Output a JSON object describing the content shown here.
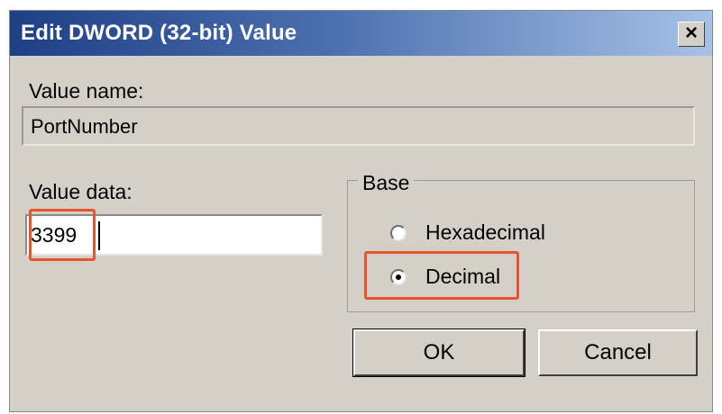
{
  "window": {
    "title": "Edit DWORD (32-bit) Value",
    "close_glyph": "✕"
  },
  "value_name": {
    "label": "Value name:",
    "value": "PortNumber"
  },
  "value_data": {
    "label": "Value data:",
    "value": "3399"
  },
  "base": {
    "legend": "Base",
    "options": [
      {
        "label": "Hexadecimal",
        "selected": false
      },
      {
        "label": "Decimal",
        "selected": true
      }
    ]
  },
  "buttons": {
    "ok": "OK",
    "cancel": "Cancel"
  },
  "colors": {
    "highlight": "#e6552f",
    "dialog_bg": "#d4d0c8",
    "title_start": "#1f3f86",
    "title_end": "#a6c1e6"
  }
}
